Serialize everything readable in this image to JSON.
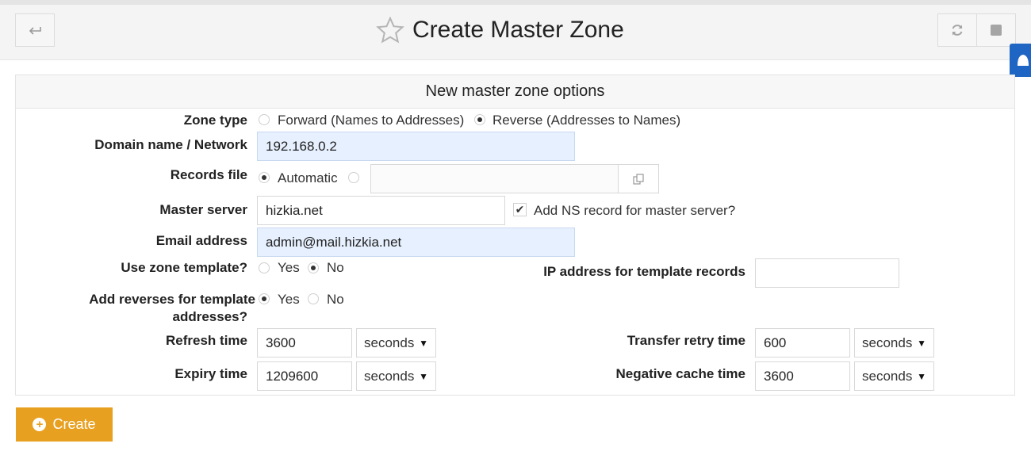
{
  "header": {
    "title": "Create Master Zone",
    "back_icon": "arrow-return-icon",
    "refresh_icon": "refresh-icon",
    "stop_icon": "stop-square-icon",
    "star_icon": "star-outline-icon"
  },
  "panel": {
    "heading": "New master zone options"
  },
  "form": {
    "zone_type": {
      "label": "Zone type",
      "options": [
        "Forward (Names to Addresses)",
        "Reverse (Addresses to Names)"
      ],
      "selected": "Reverse (Addresses to Names)"
    },
    "domain": {
      "label": "Domain name / Network",
      "value": "192.168.0.2"
    },
    "records_file": {
      "label": "Records file",
      "automatic_label": "Automatic",
      "selected": "Automatic",
      "path_value": "",
      "chooser_icon": "file-chooser-icon"
    },
    "master_server": {
      "label": "Master server",
      "value": "hizkia.net",
      "add_ns_label": "Add NS record for master server?",
      "add_ns_checked": true
    },
    "email": {
      "label": "Email address",
      "value": "admin@mail.hizkia.net"
    },
    "use_template": {
      "label": "Use zone template?",
      "yes": "Yes",
      "no": "No",
      "selected": "No"
    },
    "ip_template": {
      "label": "IP address for template records",
      "value": ""
    },
    "add_reverses": {
      "label_line1": "Add reverses for template",
      "label_line2": "addresses?",
      "yes": "Yes",
      "no": "No",
      "selected": "Yes"
    },
    "refresh": {
      "label": "Refresh time",
      "value": "3600",
      "unit": "seconds"
    },
    "transfer_retry": {
      "label": "Transfer retry time",
      "value": "600",
      "unit": "seconds"
    },
    "expiry": {
      "label": "Expiry time",
      "value": "1209600",
      "unit": "seconds"
    },
    "negative_cache": {
      "label": "Negative cache time",
      "value": "3600",
      "unit": "seconds"
    }
  },
  "actions": {
    "create_label": "Create",
    "create_icon": "plus-circle-icon"
  },
  "colors": {
    "accent": "#e8a020",
    "highlight_input": "#e7f0fe",
    "side_tab": "#1e65c4"
  }
}
